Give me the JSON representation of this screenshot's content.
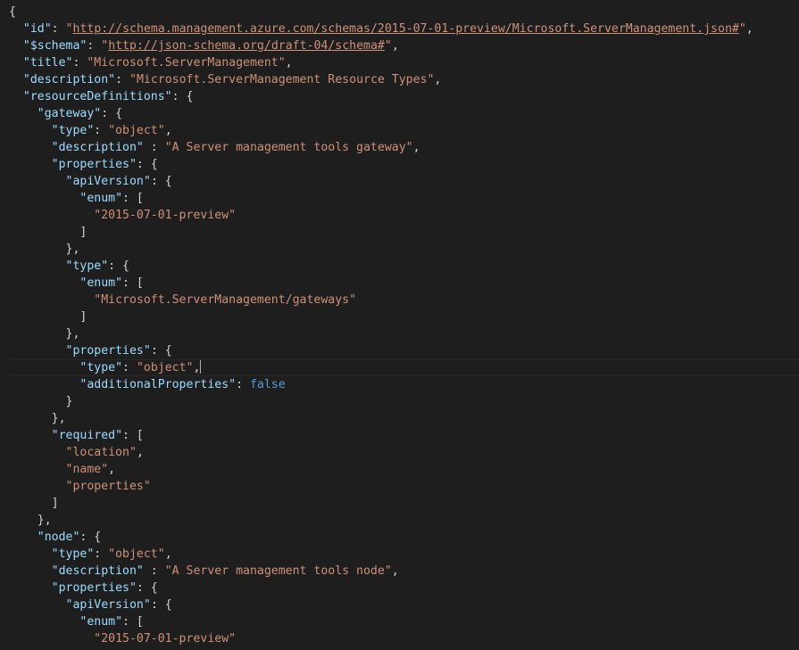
{
  "editor": {
    "lines": [
      {
        "indent": "",
        "tokens": [
          {
            "t": "p",
            "v": "{"
          }
        ]
      },
      {
        "indent": "  ",
        "tokens": [
          {
            "t": "k",
            "v": "\"id\""
          },
          {
            "t": "p",
            "v": ": "
          },
          {
            "t": "s",
            "v": "\""
          },
          {
            "t": "u",
            "v": "http://schema.management.azure.com/schemas/2015-07-01-preview/Microsoft.ServerManagement.json#"
          },
          {
            "t": "s",
            "v": "\""
          },
          {
            "t": "p",
            "v": ","
          }
        ]
      },
      {
        "indent": "  ",
        "tokens": [
          {
            "t": "k",
            "v": "\"$schema\""
          },
          {
            "t": "p",
            "v": ": "
          },
          {
            "t": "s",
            "v": "\""
          },
          {
            "t": "u",
            "v": "http://json-schema.org/draft-04/schema#"
          },
          {
            "t": "s",
            "v": "\""
          },
          {
            "t": "p",
            "v": ","
          }
        ]
      },
      {
        "indent": "  ",
        "tokens": [
          {
            "t": "k",
            "v": "\"title\""
          },
          {
            "t": "p",
            "v": ": "
          },
          {
            "t": "s",
            "v": "\"Microsoft.ServerManagement\""
          },
          {
            "t": "p",
            "v": ","
          }
        ]
      },
      {
        "indent": "  ",
        "tokens": [
          {
            "t": "k",
            "v": "\"description\""
          },
          {
            "t": "p",
            "v": ": "
          },
          {
            "t": "s",
            "v": "\"Microsoft.ServerManagement Resource Types\""
          },
          {
            "t": "p",
            "v": ","
          }
        ]
      },
      {
        "indent": "  ",
        "tokens": [
          {
            "t": "k",
            "v": "\"resourceDefinitions\""
          },
          {
            "t": "p",
            "v": ": {"
          }
        ]
      },
      {
        "indent": "    ",
        "tokens": [
          {
            "t": "k",
            "v": "\"gateway\""
          },
          {
            "t": "p",
            "v": ": {"
          }
        ]
      },
      {
        "indent": "      ",
        "tokens": [
          {
            "t": "k",
            "v": "\"type\""
          },
          {
            "t": "p",
            "v": ": "
          },
          {
            "t": "s",
            "v": "\"object\""
          },
          {
            "t": "p",
            "v": ","
          }
        ]
      },
      {
        "indent": "      ",
        "tokens": [
          {
            "t": "k",
            "v": "\"description\""
          },
          {
            "t": "p",
            "v": " : "
          },
          {
            "t": "s",
            "v": "\"A Server management tools gateway\""
          },
          {
            "t": "p",
            "v": ","
          }
        ]
      },
      {
        "indent": "      ",
        "tokens": [
          {
            "t": "k",
            "v": "\"properties\""
          },
          {
            "t": "p",
            "v": ": {"
          }
        ]
      },
      {
        "indent": "        ",
        "tokens": [
          {
            "t": "k",
            "v": "\"apiVersion\""
          },
          {
            "t": "p",
            "v": ": {"
          }
        ]
      },
      {
        "indent": "          ",
        "tokens": [
          {
            "t": "k",
            "v": "\"enum\""
          },
          {
            "t": "p",
            "v": ": ["
          }
        ]
      },
      {
        "indent": "            ",
        "tokens": [
          {
            "t": "s",
            "v": "\"2015-07-01-preview\""
          }
        ]
      },
      {
        "indent": "          ",
        "tokens": [
          {
            "t": "p",
            "v": "]"
          }
        ]
      },
      {
        "indent": "        ",
        "tokens": [
          {
            "t": "p",
            "v": "},"
          }
        ]
      },
      {
        "indent": "        ",
        "tokens": [
          {
            "t": "k",
            "v": "\"type\""
          },
          {
            "t": "p",
            "v": ": {"
          }
        ]
      },
      {
        "indent": "          ",
        "tokens": [
          {
            "t": "k",
            "v": "\"enum\""
          },
          {
            "t": "p",
            "v": ": ["
          }
        ]
      },
      {
        "indent": "            ",
        "tokens": [
          {
            "t": "s",
            "v": "\"Microsoft.ServerManagement/gateways\""
          }
        ]
      },
      {
        "indent": "          ",
        "tokens": [
          {
            "t": "p",
            "v": "]"
          }
        ]
      },
      {
        "indent": "        ",
        "tokens": [
          {
            "t": "p",
            "v": "},"
          }
        ]
      },
      {
        "indent": "        ",
        "tokens": [
          {
            "t": "k",
            "v": "\"properties\""
          },
          {
            "t": "p",
            "v": ": {"
          }
        ]
      },
      {
        "indent": "          ",
        "current": true,
        "tokens": [
          {
            "t": "k",
            "v": "\"type\""
          },
          {
            "t": "p",
            "v": ": "
          },
          {
            "t": "s",
            "v": "\"object\""
          },
          {
            "t": "p",
            "v": ","
          }
        ]
      },
      {
        "indent": "          ",
        "tokens": [
          {
            "t": "k",
            "v": "\"additionalProperties\""
          },
          {
            "t": "p",
            "v": ": "
          },
          {
            "t": "b",
            "v": "false"
          }
        ]
      },
      {
        "indent": "        ",
        "tokens": [
          {
            "t": "p",
            "v": "}"
          }
        ]
      },
      {
        "indent": "      ",
        "tokens": [
          {
            "t": "p",
            "v": "},"
          }
        ]
      },
      {
        "indent": "      ",
        "tokens": [
          {
            "t": "k",
            "v": "\"required\""
          },
          {
            "t": "p",
            "v": ": ["
          }
        ]
      },
      {
        "indent": "        ",
        "tokens": [
          {
            "t": "s",
            "v": "\"location\""
          },
          {
            "t": "p",
            "v": ","
          }
        ]
      },
      {
        "indent": "        ",
        "tokens": [
          {
            "t": "s",
            "v": "\"name\""
          },
          {
            "t": "p",
            "v": ","
          }
        ]
      },
      {
        "indent": "        ",
        "tokens": [
          {
            "t": "s",
            "v": "\"properties\""
          }
        ]
      },
      {
        "indent": "      ",
        "tokens": [
          {
            "t": "p",
            "v": "]"
          }
        ]
      },
      {
        "indent": "    ",
        "tokens": [
          {
            "t": "p",
            "v": "},"
          }
        ]
      },
      {
        "indent": "    ",
        "tokens": [
          {
            "t": "k",
            "v": "\"node\""
          },
          {
            "t": "p",
            "v": ": {"
          }
        ]
      },
      {
        "indent": "      ",
        "tokens": [
          {
            "t": "k",
            "v": "\"type\""
          },
          {
            "t": "p",
            "v": ": "
          },
          {
            "t": "s",
            "v": "\"object\""
          },
          {
            "t": "p",
            "v": ","
          }
        ]
      },
      {
        "indent": "      ",
        "tokens": [
          {
            "t": "k",
            "v": "\"description\""
          },
          {
            "t": "p",
            "v": " : "
          },
          {
            "t": "s",
            "v": "\"A Server management tools node\""
          },
          {
            "t": "p",
            "v": ","
          }
        ]
      },
      {
        "indent": "      ",
        "tokens": [
          {
            "t": "k",
            "v": "\"properties\""
          },
          {
            "t": "p",
            "v": ": {"
          }
        ]
      },
      {
        "indent": "        ",
        "tokens": [
          {
            "t": "k",
            "v": "\"apiVersion\""
          },
          {
            "t": "p",
            "v": ": {"
          }
        ]
      },
      {
        "indent": "          ",
        "tokens": [
          {
            "t": "k",
            "v": "\"enum\""
          },
          {
            "t": "p",
            "v": ": ["
          }
        ]
      },
      {
        "indent": "            ",
        "tokens": [
          {
            "t": "s",
            "v": "\"2015-07-01-preview\""
          }
        ]
      }
    ]
  }
}
